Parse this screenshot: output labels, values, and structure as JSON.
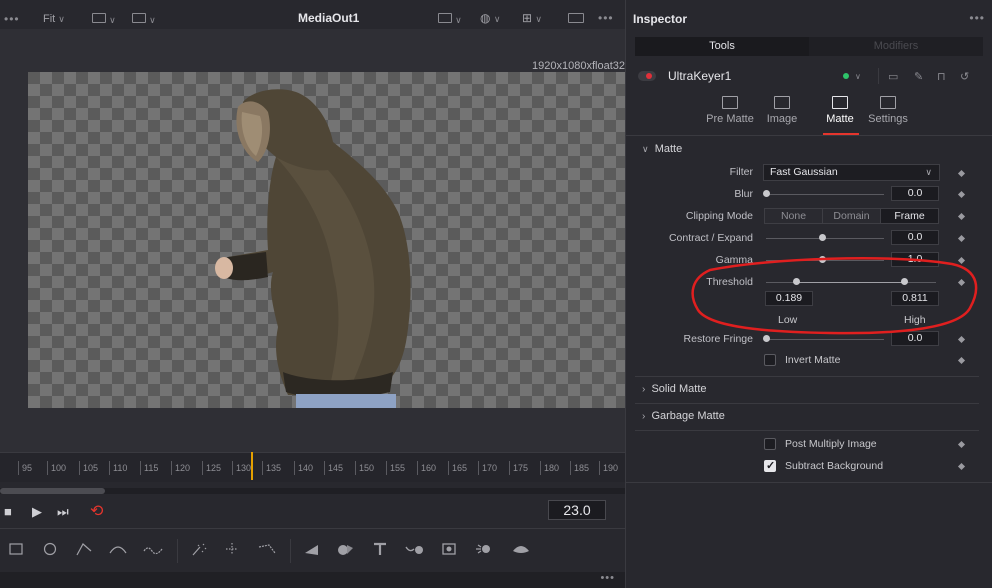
{
  "viewer": {
    "fit_label": "Fit",
    "title": "MediaOut1",
    "resolution": "1920x1080xfloat32",
    "timeline_ticks": [
      "95",
      "100",
      "105",
      "110",
      "115",
      "120",
      "125",
      "130",
      "135",
      "140",
      "145",
      "150",
      "155",
      "160",
      "165",
      "170",
      "175",
      "180",
      "185",
      "190"
    ],
    "current_frame": "23.0",
    "toolbar_dots": "•••",
    "bottom_dots": "•••"
  },
  "inspector": {
    "title": "Inspector",
    "menu_dots": "•••",
    "tabs": {
      "tools": "Tools",
      "modifiers": "Modifiers"
    },
    "node_name": "UltraKeyer1",
    "subtabs": [
      "Pre Matte",
      "Image",
      "Matte",
      "Settings"
    ],
    "active_subtab": "Matte",
    "sections": {
      "matte": "Matte",
      "solid_matte": "Solid Matte",
      "garbage_matte": "Garbage Matte"
    },
    "fields": {
      "filter_label": "Filter",
      "filter_value": "Fast Gaussian",
      "blur_label": "Blur",
      "blur_value": "0.0",
      "clipping_label": "Clipping Mode",
      "clipping_options": [
        "None",
        "Domain",
        "Frame"
      ],
      "clipping_selected": "Frame",
      "contract_label": "Contract / Expand",
      "contract_value": "0.0",
      "gamma_label": "Gamma",
      "gamma_value": "1.0",
      "threshold_label": "Threshold",
      "threshold_low": "0.189",
      "threshold_high": "0.811",
      "low_label": "Low",
      "high_label": "High",
      "restore_label": "Restore Fringe",
      "restore_value": "0.0",
      "invert_label": "Invert Matte",
      "post_multiply_label": "Post Multiply Image",
      "subtract_bg_label": "Subtract Background"
    },
    "checkboxes": {
      "invert_matte": false,
      "post_multiply": false,
      "subtract_background": true
    }
  },
  "colors": {
    "accent_red": "#e5352d",
    "playhead": "#e5a000",
    "node_active": "#2ec46a"
  }
}
